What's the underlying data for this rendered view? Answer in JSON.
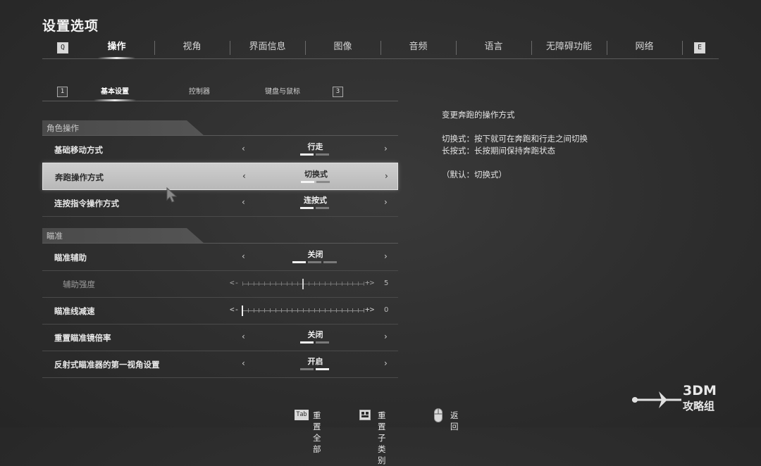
{
  "title": "设置选项",
  "top_tabs": {
    "left_key": "Q",
    "right_key": "E",
    "items": [
      "操作",
      "视角",
      "界面信息",
      "图像",
      "音频",
      "语言",
      "无障碍功能",
      "网络"
    ],
    "active_index": 0
  },
  "sub_tabs": {
    "left_key": "1",
    "right_key": "3",
    "items": [
      "基本设置",
      "控制器",
      "键盘与鼠标"
    ],
    "active_index": 0
  },
  "sections": [
    {
      "label": "角色操作"
    },
    {
      "label": "瞄准"
    }
  ],
  "rows": [
    {
      "label": "基础移动方式",
      "type": "select",
      "value": "行走",
      "option_count": 2,
      "selected_option": 1
    },
    {
      "label": "奔跑操作方式",
      "type": "select",
      "value": "切换式",
      "option_count": 2,
      "selected_option": 1,
      "focused": true
    },
    {
      "label": "连按指令操作方式",
      "type": "select",
      "value": "连按式",
      "option_count": 2,
      "selected_option": 1
    },
    {
      "label": "瞄准辅助",
      "type": "select",
      "value": "关闭",
      "option_count": 3,
      "selected_option": 1
    },
    {
      "label": "辅助强度",
      "type": "slider",
      "value": "5",
      "min": 0,
      "max": 10,
      "disabled": true
    },
    {
      "label": "瞄准线减速",
      "type": "slider",
      "value": "0",
      "min": 0,
      "max": 10
    },
    {
      "label": "重置瞄准镜倍率",
      "type": "select",
      "value": "关闭",
      "option_count": 2,
      "selected_option": 1
    },
    {
      "label": "反射式瞄准器的第一视角设置",
      "type": "select",
      "value": "开启",
      "option_count": 2,
      "selected_option": 2
    }
  ],
  "slider_caps": {
    "minus": "<-",
    "plus": "+>"
  },
  "arrows": {
    "left": "‹",
    "right": "›"
  },
  "description": {
    "heading": "变更奔跑的操作方式",
    "lines": [
      "切换式：按下就可在奔跑和行走之间切换",
      "长按式：长按期间保持奔跑状态"
    ],
    "default": "（默认：切换式）"
  },
  "footer": {
    "reset_all_key": "Tab",
    "reset_all": "重置全部",
    "reset_category": "重置子类别",
    "back": "返回"
  },
  "watermark": {
    "line1": "3DM",
    "line2": "攻略组"
  },
  "colors": {
    "background": "#2e2e2e",
    "selected_row": "#c4c4c4",
    "text": "#e6e6e6"
  }
}
